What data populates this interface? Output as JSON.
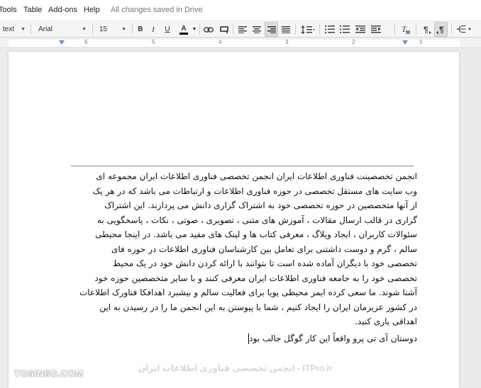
{
  "menu": {
    "tools": "Tools",
    "table": "Table",
    "addons": "Add-ons",
    "help": "Help",
    "save_status": "All changes saved in Drive"
  },
  "toolbar": {
    "style_value": "text",
    "font_value": "Arial",
    "size_value": "15",
    "bold": "B",
    "italic": "I",
    "underline": "U",
    "text_color": "A",
    "text_color_hex": "#000000",
    "accent_hex": "#4d90fe"
  },
  "ruler": {
    "numbers": [
      "6",
      "5",
      "4",
      "3",
      "2",
      "1"
    ]
  },
  "document": {
    "lines": [
      "انجمن تخصصینت فناوری اطلاعات ایران انجمن تخصصی فناوری اطلاعات ایران مجموعه ای",
      "وب سایت های مستقل تخصصی در حوزه فناوری اطلاعات و ارتباطات می باشد که در هر یک",
      "از آنها متخصصین در حوزه تخصصی خود به اشتراک گزاری دانش می پردازند. این اشتراک",
      "گزاری در قالب ارسال مقالات ، آموزش های متنی ، تصویری ، صوتی ، نکات ، پاسخگویی به",
      "سئوالات کاربران ، ایجاد ویلاگ ، معرفی کتاب ها و لینک های مفید می باشد. در اینجا محیطی",
      "سالم ، گرم و دوست داشتنی برای تعامل بین کارشناسان فناوری اطلاعات در حوزه فای",
      "تخصصی خود با دیگران آماده شده است تا بتوانند با ارائه کردن دانش خود در یک محیط",
      "تخصصی خود را به جامعه فناوری اطلاعات ایران معرفی کنند و با سایر متخصصین حوزه خود",
      "آشنا شوند. ما سعی کرده ایمر محیطی پویا برای فعالیت سالم و بیشبرد اهدافکا فناورک اطلاعات",
      "در کشور عزیزمان ایران را ایجاد کنیم ، شما با پیوستن به این انجمن ما را در رسیدن به این",
      "اهداقی یاری کنید."
    ],
    "last_line": "دوستان آی تی پرو واقعاً این کار گوگل جالب بود"
  },
  "watermark": {
    "left": "TOSINSO.COM",
    "right": "ITPro.ir - انجمن تخصصی فناوری اطلاعات ایران"
  }
}
